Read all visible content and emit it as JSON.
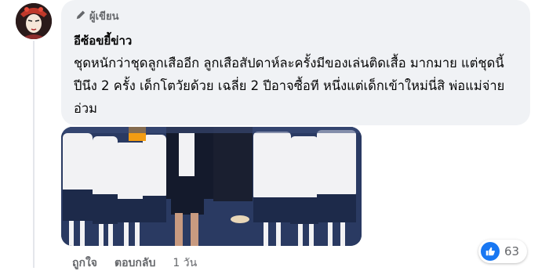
{
  "comment": {
    "badge_label": "ผู้เขียน",
    "author": "อีซ้อขยี้ข่าว",
    "text": "ชุดหนักว่าชุดลูกเสืออีก ลูกเสือสัปดาห์ละครั้งมีของเล่นติดเสื้อ มากมาย แต่ชุดนี้ ปีนึง 2 ครั้ง เด็กโตวัยด้วย เฉลี่ย 2 ปีอาจซื้อที หนึ่งแต่เด็กเข้าใหม่นี่สิ พ่อแม่จ่ายอ่วม"
  },
  "actions": {
    "like": "ถูกใจ",
    "reply": "ตอบกลับ",
    "time": "1 วัน"
  },
  "reactions": {
    "count": "63",
    "icon": "like-icon",
    "color": "#1877f2"
  }
}
